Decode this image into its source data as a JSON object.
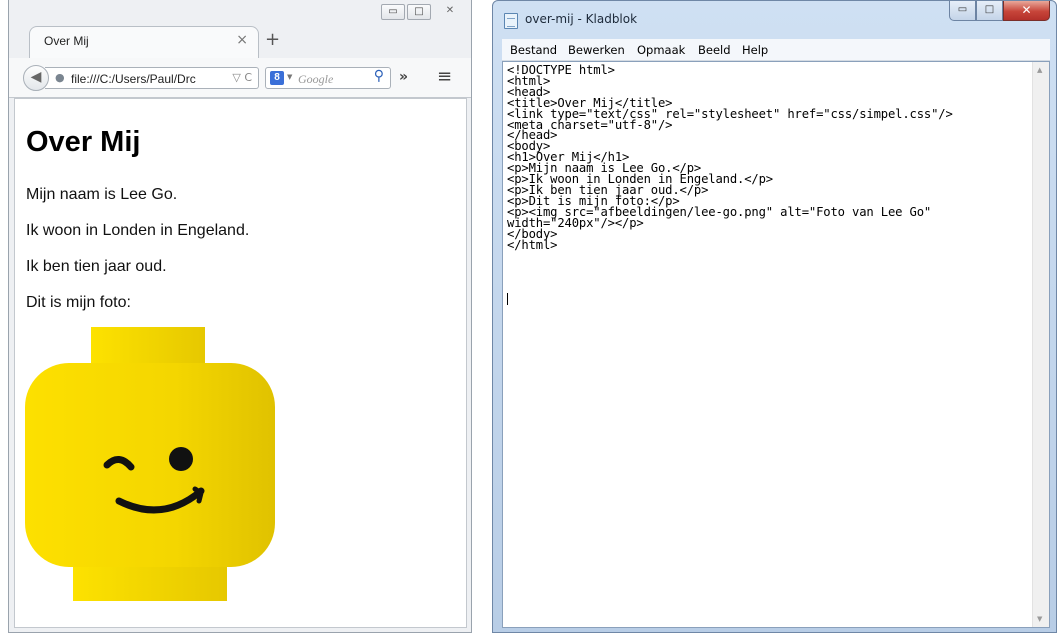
{
  "browser": {
    "window_controls": {
      "minimize": "▭",
      "maximize": "□",
      "close": "✕"
    },
    "tab": {
      "title": "Over Mij",
      "close": "×",
      "new_tab": "+"
    },
    "url": "file:///C:/Users/Paul/Drc",
    "url_icons": "▽ C",
    "search_engine_icon": "8",
    "search_placeholder": "Google",
    "overflow": "»",
    "menu": "≡",
    "page": {
      "heading": "Over Mij",
      "paragraphs": [
        "Mijn naam is Lee Go.",
        "Ik woon in Londen in Engeland.",
        "Ik ben tien jaar oud.",
        "Dit is mijn foto:"
      ],
      "image": {
        "depicts": "lego-head-winking",
        "color": "#f2d400"
      }
    }
  },
  "notepad": {
    "title": "over-mij - Kladblok",
    "window_controls": {
      "minimize": "▭",
      "maximize": "□",
      "close": "✕"
    },
    "menus": [
      "Bestand",
      "Bewerken",
      "Opmaak",
      "Beeld",
      "Help"
    ],
    "lines": [
      "<!DOCTYPE html>",
      "<html>",
      "<head>",
      "<title>Over Mij</title>",
      "<link type=\"text/css\" rel=\"stylesheet\" href=\"css/simpel.css\"/>",
      "<meta charset=\"utf-8\"/>",
      "</head>",
      "<body>",
      "<h1>Over Mij</h1>",
      "<p>Mijn naam is Lee Go.</p>",
      "<p>Ik woon in Londen in Engeland.</p>",
      "<p>Ik ben tien jaar oud.</p>",
      "<p>Dit is mijn foto:</p>",
      "<p><img src=\"afbeeldingen/lee-go.png\" alt=\"Foto van Lee Go\"",
      "width=\"240px\"/></p>",
      "</body>",
      "</html>"
    ],
    "accent_close": "#c7453a"
  }
}
